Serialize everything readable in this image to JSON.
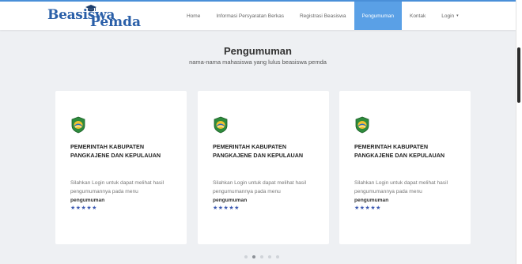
{
  "brand": {
    "main": "Beasiswa",
    "sub": "Pemda"
  },
  "nav": {
    "items": [
      {
        "label": "Home"
      },
      {
        "label": "Informasi Persyaratan Berkas"
      },
      {
        "label": "Registrasi Beasiswa"
      },
      {
        "label": "Pengumuman",
        "active": true
      },
      {
        "label": "Kontak"
      },
      {
        "label": "Login"
      }
    ]
  },
  "section": {
    "title": "Pengumuman",
    "subtitle": "nama-nama mahasiswa yang lulus beasiswa pemda"
  },
  "cards": [
    {
      "title": "PEMERINTAH KABUPATEN PANGKAJENE DAN KEPULAUAN",
      "text": "Silahkan Login untuk dapat melihat hasil pengumumannya pada menu",
      "link": "pengumuman",
      "rating": "★★★★★"
    },
    {
      "title": "PEMERINTAH KABUPATEN PANGKAJENE DAN KEPULAUAN",
      "text": "Silahkan Login untuk dapat melihat hasil pengumumannya pada menu",
      "link": "pengumuman",
      "rating": "★★★★★"
    },
    {
      "title": "PEMERINTAH KABUPATEN PANGKAJENE DAN KEPULAUAN",
      "text": "Silahkan Login untuk dapat melihat hasil pengumumannya pada menu",
      "link": "pengumuman",
      "rating": "★★★★★"
    }
  ],
  "carousel": {
    "total": 5,
    "active": 2
  },
  "colors": {
    "accent": "#5aa0e6",
    "brand": "#2a5fa8",
    "stars": "#3b58b0",
    "emblem_green": "#2e8b3d"
  },
  "icons": {
    "logo": "graduation-cap-icon",
    "card": "regency-emblem-icon",
    "caret": "caret-down-icon"
  }
}
